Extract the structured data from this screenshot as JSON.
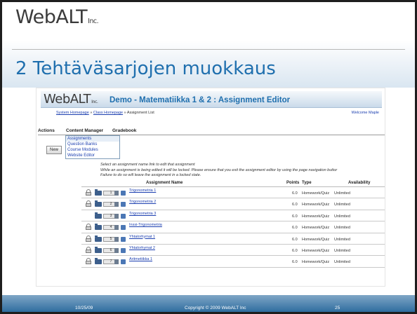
{
  "slide": {
    "logo": {
      "main": "WebALT",
      "suffix": "Inc."
    },
    "title": "2 Tehtäväsarjojen muokkaus"
  },
  "app": {
    "logo": {
      "main": "WebALT",
      "suffix": "Inc."
    },
    "title": "Demo - Matematiikka 1 & 2 : Assignment Editor",
    "breadcrumb": {
      "items": [
        "System Homepage",
        "Class Homepage",
        "Assignment List"
      ],
      "separator": "»"
    },
    "welcome": "Welcome Maple"
  },
  "menu": {
    "items": [
      "Actions",
      "Content Manager",
      "Gradebook"
    ],
    "dropdown": [
      "Assignments",
      "Question Banks",
      "Course Modules",
      "Website Editor"
    ]
  },
  "new_button": "New",
  "instructions": {
    "line1": "Select an assignment name link to edit that assignment",
    "line2": "While an assignment is being edited it will be locked.  Please ensure that you exit the assignment editor by using the page navigation buttor",
    "line3": "Failure to do so will leave the assignment in a locked state."
  },
  "table": {
    "headers": {
      "name": "Assignment Name",
      "points": "Points",
      "type": "Type",
      "availability": "Availability"
    },
    "rows": [
      {
        "order": "1",
        "name": "Trigonometria 1",
        "points": "6.0",
        "type": "Homework/Quiz",
        "availability": "Unlimited",
        "locked": true
      },
      {
        "order": "2",
        "name": "Trigonometria 2",
        "points": "6.0",
        "type": "Homework/Quiz",
        "availability": "Unlimited",
        "locked": true
      },
      {
        "order": "3",
        "name": "Trigonometria 3",
        "points": "6.0",
        "type": "Homework/Quiz",
        "availability": "Unlimited",
        "locked": false
      },
      {
        "order": "4",
        "name": "Inssi-Trigonometria",
        "points": "6.0",
        "type": "Homework/Quiz",
        "availability": "Unlimited",
        "locked": true
      },
      {
        "order": "5",
        "name": "Yhtalorhymat 1",
        "points": "6.0",
        "type": "Homework/Quiz",
        "availability": "Unlimited",
        "locked": true
      },
      {
        "order": "6",
        "name": "Yhtalorhymat 2",
        "points": "6.0",
        "type": "Homework/Quiz",
        "availability": "Unlimited",
        "locked": true
      },
      {
        "order": "7",
        "name": "Aritmetiikka 1",
        "points": "6.0",
        "type": "Homework/Quiz",
        "availability": "Unlimited",
        "locked": true
      }
    ]
  },
  "footer": {
    "date": "10/25/09",
    "copyright": "Copyright © 2009 WebALT Inc",
    "page": "25"
  },
  "colors": {
    "title_blue": "#1f6fae",
    "link_blue": "#1c3fb0",
    "footer_blue": "#2f6d9f"
  }
}
